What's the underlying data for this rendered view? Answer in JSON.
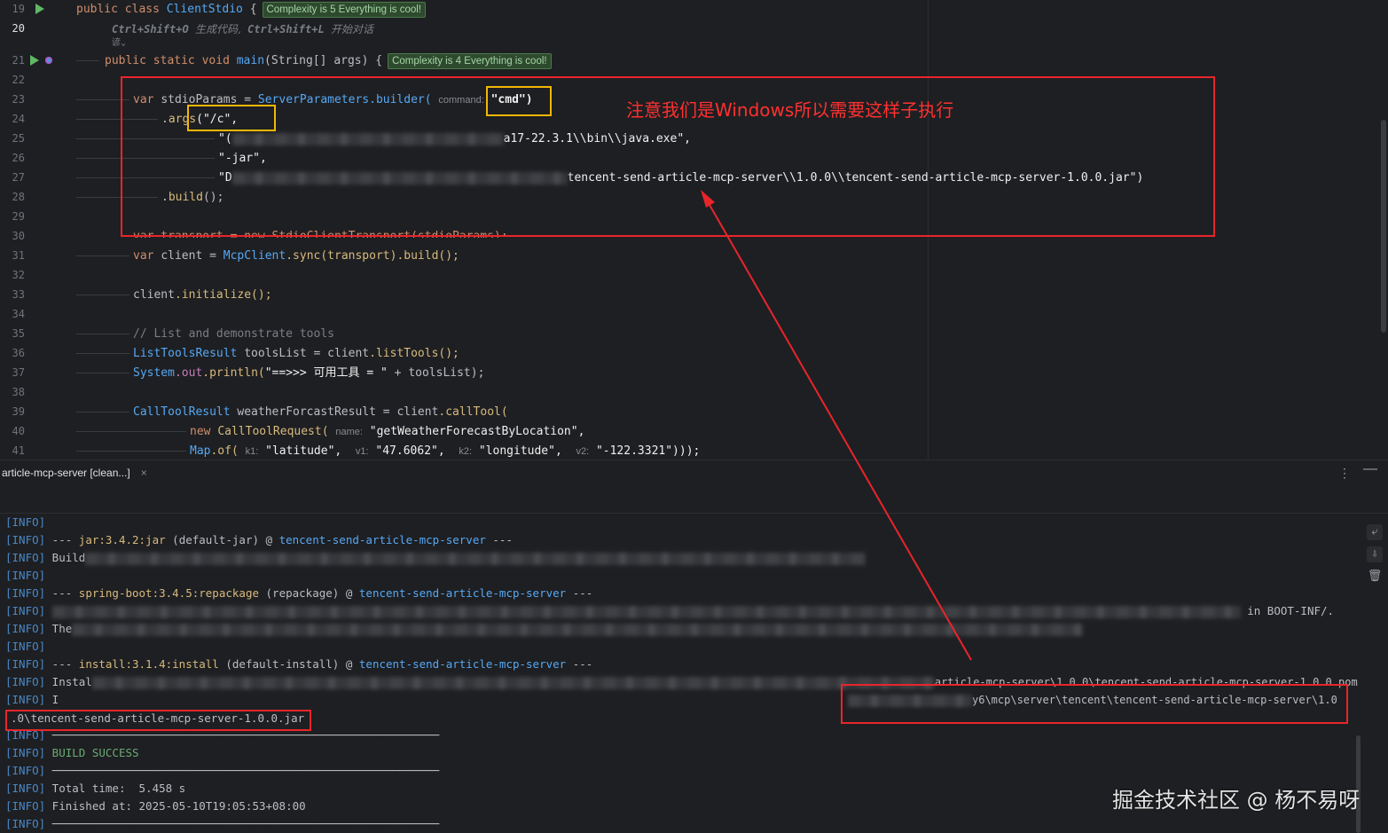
{
  "editor": {
    "lines": [
      {
        "n": "19"
      },
      {
        "n": "20"
      },
      {
        "n": "21"
      },
      {
        "n": "22"
      },
      {
        "n": "23"
      },
      {
        "n": "24"
      },
      {
        "n": "25"
      },
      {
        "n": "26"
      },
      {
        "n": "27"
      },
      {
        "n": "28"
      },
      {
        "n": "29"
      },
      {
        "n": "30"
      },
      {
        "n": "31"
      },
      {
        "n": "32"
      },
      {
        "n": "33"
      },
      {
        "n": "34"
      },
      {
        "n": "35"
      },
      {
        "n": "36"
      },
      {
        "n": "37"
      },
      {
        "n": "38"
      },
      {
        "n": "39"
      },
      {
        "n": "40"
      },
      {
        "n": "41"
      }
    ],
    "class_decl": {
      "kw1": "public",
      "kw2": "class",
      "name": "ClientStdio",
      "brace": "{",
      "badge": "Complexity is 5 Everything is cool!"
    },
    "hint_line": {
      "k1": "Ctrl+Shift+O",
      "t1": "生成代码,",
      "k2": "Ctrl+Shift+L",
      "t2": "开始对话",
      "sub": "谚⌄"
    },
    "main_decl": {
      "kw1": "public",
      "kw2": "static",
      "kw3": "void",
      "name": "main",
      "params": "(String[] args)",
      "brace": "{",
      "badge": "Complexity is 4 Everything is cool!"
    },
    "l23": {
      "kw": "var",
      "name": "stdioParams",
      "eq": " = ",
      "cls": "ServerParameters",
      "call": ".builder(",
      "hint": "command:",
      "arg": "\"cmd\")"
    },
    "l24": {
      "dot": ".",
      "fn": "args",
      "arg": "(\"/c\","
    },
    "l25": {
      "q": "\"(",
      "tail": "a17-22.3.1\\\\bin\\\\java.exe\","
    },
    "l26": {
      "s": "\"-jar\","
    },
    "l27": {
      "q": "\"D",
      "tail": "tencent-send-article-mcp-server\\\\1.0.0\\\\tencent-send-article-mcp-server-1.0.0.jar\")"
    },
    "l28": {
      "dot": ".",
      "fn": "build",
      "rest": "();"
    },
    "l30": {
      "text": "var transport = new StdioClientTransport(stdioParams);"
    },
    "l31": {
      "kw": "var",
      "name": "client",
      "eq": " = ",
      "cls": "McpClient",
      "call": ".sync(transport).build();"
    },
    "l33": {
      "name": "client",
      "call": ".initialize();"
    },
    "l35": {
      "comment": "// List and demonstrate tools"
    },
    "l36": {
      "type": "ListToolsResult",
      "name": "toolsList",
      "eq": " = ",
      "obj": "client",
      "call": ".listTools();"
    },
    "l37": {
      "cls": "System",
      "fld": ".out",
      "call": ".println(",
      "s": "\"==>>> 可用工具 = \"",
      "plus": " + ",
      "v": "toolsList",
      "end": ");"
    },
    "l39": {
      "type": "CallToolResult",
      "name": "weatherForcastResult",
      "eq": " = ",
      "obj": "client",
      "call": ".callTool("
    },
    "l40": {
      "kw": "new",
      "cls": "CallToolRequest(",
      "hint": "name:",
      "s": "\"getWeatherForecastByLocation\","
    },
    "l41": {
      "cls": "Map",
      "call": ".of(",
      "h1": "k1:",
      "s1": "\"latitude\",",
      "h2": "v1:",
      "s2": "\"47.6062\",",
      "h3": "k2:",
      "s3": "\"longitude\",",
      "h4": "v2:",
      "s4": "\"-122.3321\")));"
    },
    "note": "注意我们是Windows所以需要这样子执行"
  },
  "tab": {
    "label": "article-mcp-server [clean...]",
    "close": "×"
  },
  "toolbar": {
    "kebab": "⋮",
    "minimize": "—"
  },
  "console": {
    "lines": [
      {
        "p": "[INFO]",
        "t": ""
      },
      {
        "p": "[INFO]",
        "a": " --- ",
        "b": "jar:3.4.2:jar",
        "c": " (default-jar) @ ",
        "d": "tencent-send-article-mcp-server",
        "e": " ---"
      },
      {
        "p": "[INFO]",
        "t": " Build"
      },
      {
        "p": "[INFO]",
        "t": ""
      },
      {
        "p": "[INFO]",
        "a": " --- ",
        "b": "spring-boot:3.4.5:repackage",
        "c": " (repackage) @ ",
        "d": "tencent-send-article-mcp-server",
        "e": " ---"
      },
      {
        "p": "[INFO]",
        "t": " ",
        "tail": "in BOOT-INF/."
      },
      {
        "p": "[INFO]",
        "t": " The"
      },
      {
        "p": "[INFO]",
        "t": ""
      },
      {
        "p": "[INFO]",
        "a": " --- ",
        "b": "install:3.1.4:install",
        "c": " (default-install) @ ",
        "d": "tencent-send-article-mcp-server",
        "e": " ---"
      },
      {
        "p": "[INFO]",
        "t": " Instal",
        "tail": "article-mcp-server\\1.0.0\\tencent-send-article-mcp-server-1.0.0.pom"
      },
      {
        "p": "[INFO]",
        "t": " I",
        "tail": "y6\\mcp\\server\\tencent\\tencent-send-article-mcp-server\\1.0"
      },
      {
        "p": "",
        "t": ".0\\tencent-send-article-mcp-server-1.0.0.jar"
      },
      {
        "p": "[INFO]",
        "t": " ──────────────────────────────────────────────────────────"
      },
      {
        "p": "[INFO]",
        "t": " BUILD SUCCESS"
      },
      {
        "p": "[INFO]",
        "t": " ──────────────────────────────────────────────────────────"
      },
      {
        "p": "[INFO]",
        "t": " Total time:  5.458 s"
      },
      {
        "p": "[INFO]",
        "t": " Finished at: 2025-05-10T19:05:53+08:00"
      },
      {
        "p": "[INFO]",
        "t": " ──────────────────────────────────────────────────────────"
      }
    ]
  },
  "sidebar_icons": [
    "soft-wrap-icon",
    "scroll-to-end-icon",
    "trash-icon"
  ],
  "watermark": "掘金技术社区 @ 杨不易呀",
  "colors": {
    "annotation_red": "#e8252b",
    "annotation_yellow": "#f2b705",
    "bg": "#1e1f22"
  }
}
